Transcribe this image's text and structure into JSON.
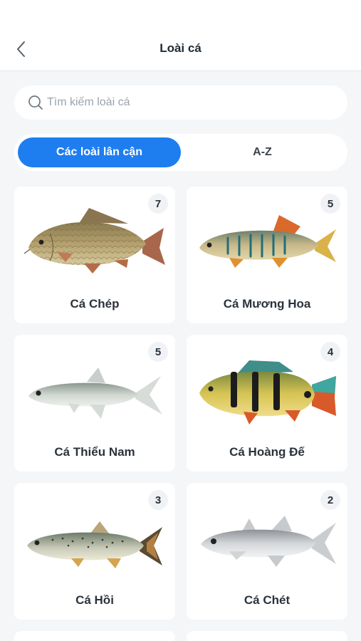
{
  "header": {
    "title": "Loài cá",
    "back_icon": "chevron-left-icon"
  },
  "search": {
    "placeholder": "Tìm kiếm loài cá",
    "value": "",
    "icon": "search-icon"
  },
  "tabs": [
    {
      "label": "Các loài lân cận",
      "active": true
    },
    {
      "label": "A-Z",
      "active": false
    }
  ],
  "colors": {
    "accent": "#1e7ef0",
    "background": "#f4f6f8"
  },
  "species": [
    {
      "name": "Cá Chép",
      "count": "7",
      "kind": "carp"
    },
    {
      "name": "Cá Mương Hoa",
      "count": "5",
      "kind": "barb"
    },
    {
      "name": "Cá Thiểu Nam",
      "count": "5",
      "kind": "thin"
    },
    {
      "name": "Cá Hoàng Đế",
      "count": "4",
      "kind": "peacock"
    },
    {
      "name": "Cá Hồi",
      "count": "3",
      "kind": "trout"
    },
    {
      "name": "Cá Chét",
      "count": "2",
      "kind": "threadfin"
    }
  ]
}
